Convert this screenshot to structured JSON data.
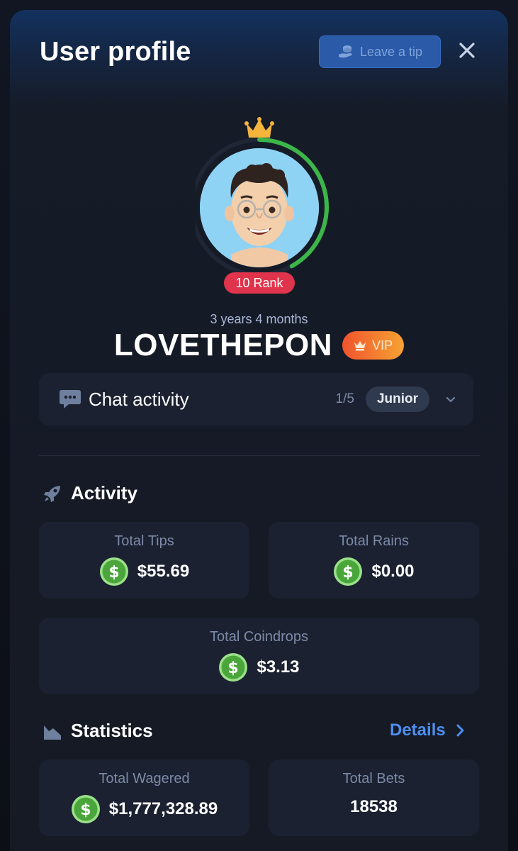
{
  "header": {
    "title": "User profile",
    "tip_label": "Leave a tip"
  },
  "profile": {
    "rank_label": "10 Rank",
    "rank_progress": 0.42,
    "member_since": "3 years 4 months",
    "username": "LOVETHEPON",
    "vip_label": "VIP"
  },
  "chat_activity": {
    "label": "Chat activity",
    "count": "1/5",
    "level": "Junior"
  },
  "activity": {
    "heading": "Activity",
    "cards": [
      {
        "label": "Total Tips",
        "value": "$55.69"
      },
      {
        "label": "Total Rains",
        "value": "$0.00"
      },
      {
        "label": "Total Coindrops",
        "value": "$3.13"
      }
    ]
  },
  "statistics": {
    "heading": "Statistics",
    "details_label": "Details",
    "cards": [
      {
        "label": "Total Wagered",
        "value": "$1,777,328.89"
      },
      {
        "label": "Total Bets",
        "value": "18538"
      }
    ]
  },
  "colors": {
    "accent_blue": "#4d8ef0",
    "rank_red": "#e0344c",
    "progress_green": "#3cb54a",
    "coin_green": "#4aa63a"
  }
}
